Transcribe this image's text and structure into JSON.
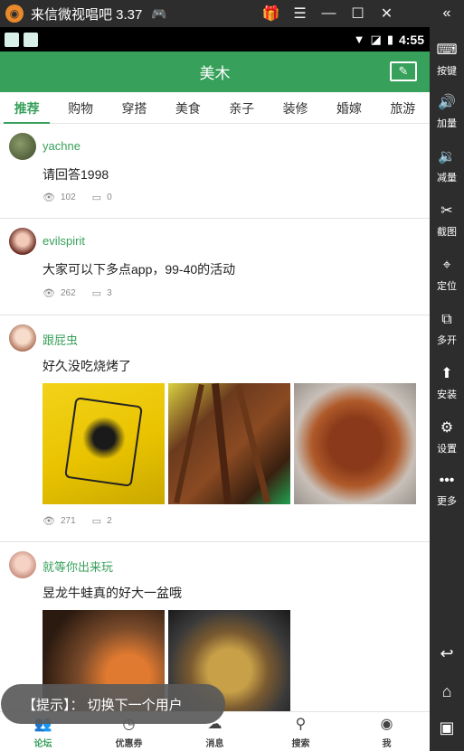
{
  "emulator": {
    "title": "来信微视唱吧 3.37",
    "sidebar": [
      {
        "label": "按键",
        "icon": "keyboard-icon"
      },
      {
        "label": "加量",
        "icon": "volume-up-icon"
      },
      {
        "label": "减量",
        "icon": "volume-down-icon"
      },
      {
        "label": "截图",
        "icon": "scissors-icon"
      },
      {
        "label": "定位",
        "icon": "location-pin-icon"
      },
      {
        "label": "多开",
        "icon": "multi-window-icon"
      },
      {
        "label": "安装",
        "icon": "apk-install-icon"
      },
      {
        "label": "设置",
        "icon": "gear-icon"
      },
      {
        "label": "更多",
        "icon": "more-dots-icon"
      }
    ]
  },
  "status_bar": {
    "time": "4:55"
  },
  "header": {
    "title": "美木"
  },
  "tabs": [
    "推荐",
    "购物",
    "穿搭",
    "美食",
    "亲子",
    "装修",
    "婚嫁",
    "旅游"
  ],
  "posts": [
    {
      "username": "yachne",
      "text": "请回答1998",
      "views": "102",
      "comments": "0"
    },
    {
      "username": "evilspirit",
      "text": "大家可以下多点app，99-40的活动",
      "views": "262",
      "comments": "3"
    },
    {
      "username": "跟屁虫",
      "text": "好久没吃烧烤了",
      "views": "271",
      "comments": "2"
    },
    {
      "username": "就等你出来玩",
      "text": "昱龙牛蛙真的好大一盆哦"
    }
  ],
  "bottom_nav": [
    "论坛",
    "优惠券",
    "消息",
    "搜索",
    "我"
  ],
  "toast": "【提示】： 切换下一个用户",
  "colors": {
    "accent": "#37a05a",
    "emulator_chrome": "#2d2d2d"
  }
}
